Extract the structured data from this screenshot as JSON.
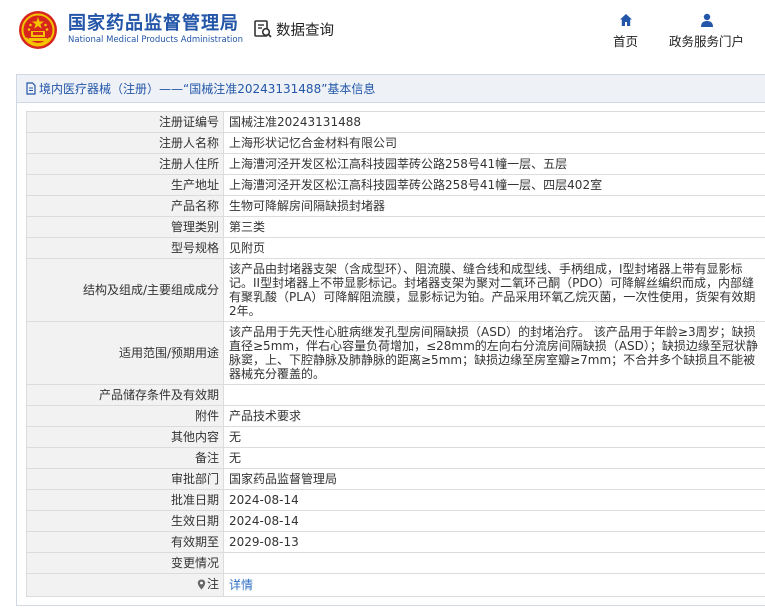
{
  "header": {
    "brand_cn": "国家药品监督管理局",
    "brand_en": "National Medical Products Administration",
    "data_query": "数据查询",
    "nav": {
      "home": "首页",
      "gov_portal": "政务服务门户"
    }
  },
  "panel": {
    "breadcrumb": "境内医疗器械（注册）——“国械注准20243131488”基本信息"
  },
  "details": [
    {
      "key": "注册证编号",
      "value": "国械注准20243131488"
    },
    {
      "key": "注册人名称",
      "value": "上海形状记忆合金材料有限公司"
    },
    {
      "key": "注册人住所",
      "value": "上海漕河泾开发区松江高科技园莘砖公路258号41幢一层、五层"
    },
    {
      "key": "生产地址",
      "value": "上海漕河泾开发区松江高科技园莘砖公路258号41幢一层、四层402室"
    },
    {
      "key": "产品名称",
      "value": "生物可降解房间隔缺损封堵器"
    },
    {
      "key": "管理类别",
      "value": "第三类"
    },
    {
      "key": "型号规格",
      "value": "见附页"
    },
    {
      "key": "结构及组成/主要组成成分",
      "value": "该产品由封堵器支架（含成型环）、阻流膜、缝合线和成型线、手柄组成，I型封堵器上带有显影标记。II型封堵器上不带显影标记。封堵器支架为聚对二氧环己酮（PDO）可降解丝编织而成，内部缝有聚乳酸（PLA）可降解阻流膜，显影标记为铂。产品采用环氧乙烷灭菌，一次性使用，货架有效期2年。"
    },
    {
      "key": "适用范围/预期用途",
      "value": "该产品用于先天性心脏病继发孔型房间隔缺损（ASD）的封堵治疗。 该产品用于年龄≥3周岁；缺损直径≥5mm，伴右心容量负荷增加，≤28mm的左向右分流房间隔缺损（ASD）；缺损边缘至冠状静脉窦，上、下腔静脉及肺静脉的距离≥5mm；缺损边缘至房室瓣≥7mm；不合并多个缺损且不能被器械充分覆盖的。"
    },
    {
      "key": "产品储存条件及有效期",
      "value": ""
    },
    {
      "key": "附件",
      "value": "产品技术要求"
    },
    {
      "key": "其他内容",
      "value": "无"
    },
    {
      "key": "备注",
      "value": "无"
    },
    {
      "key": "审批部门",
      "value": "国家药品监督管理局"
    },
    {
      "key": "批准日期",
      "value": "2024-08-14"
    },
    {
      "key": "生效日期",
      "value": "2024-08-14"
    },
    {
      "key": "有效期至",
      "value": "2029-08-13"
    },
    {
      "key": "变更情况",
      "value": ""
    }
  ],
  "note_row": {
    "key": "注",
    "link": "详情"
  },
  "colors": {
    "brand_blue": "#2356a8",
    "link_blue": "#2f6fc4",
    "key_bg": "#f2f2f2",
    "title_bg": "#eef2f7",
    "emblem_red": "#d7261e",
    "emblem_gold": "#f5c400"
  },
  "icons": {
    "logo": "national-emblem-icon",
    "data_query": "document-search-icon",
    "home": "home-icon",
    "gov_portal": "user-icon",
    "breadcrumb": "document-icon",
    "note": "map-pin-icon"
  }
}
